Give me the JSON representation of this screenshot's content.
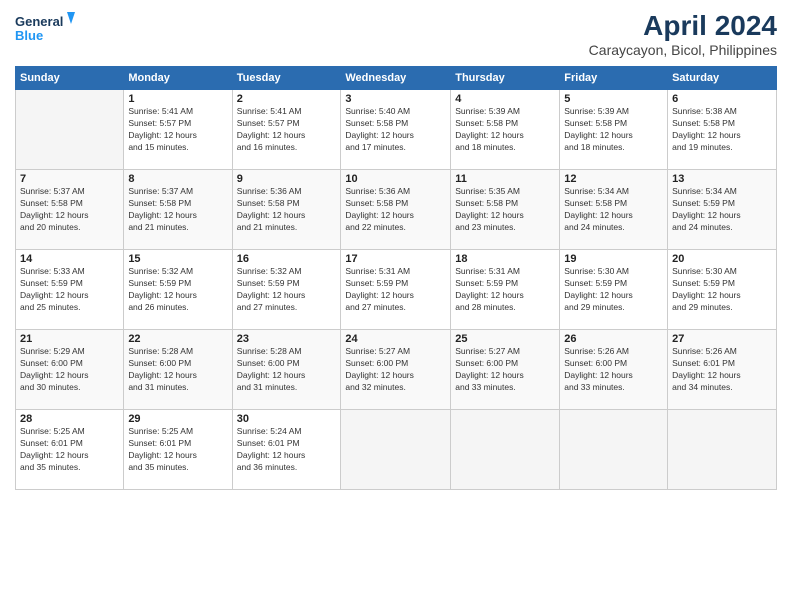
{
  "logo": {
    "line1": "General",
    "line2": "Blue"
  },
  "title": "April 2024",
  "subtitle": "Caraycayon, Bicol, Philippines",
  "days_header": [
    "Sunday",
    "Monday",
    "Tuesday",
    "Wednesday",
    "Thursday",
    "Friday",
    "Saturday"
  ],
  "weeks": [
    [
      {
        "num": "",
        "info": ""
      },
      {
        "num": "1",
        "info": "Sunrise: 5:41 AM\nSunset: 5:57 PM\nDaylight: 12 hours\nand 15 minutes."
      },
      {
        "num": "2",
        "info": "Sunrise: 5:41 AM\nSunset: 5:57 PM\nDaylight: 12 hours\nand 16 minutes."
      },
      {
        "num": "3",
        "info": "Sunrise: 5:40 AM\nSunset: 5:58 PM\nDaylight: 12 hours\nand 17 minutes."
      },
      {
        "num": "4",
        "info": "Sunrise: 5:39 AM\nSunset: 5:58 PM\nDaylight: 12 hours\nand 18 minutes."
      },
      {
        "num": "5",
        "info": "Sunrise: 5:39 AM\nSunset: 5:58 PM\nDaylight: 12 hours\nand 18 minutes."
      },
      {
        "num": "6",
        "info": "Sunrise: 5:38 AM\nSunset: 5:58 PM\nDaylight: 12 hours\nand 19 minutes."
      }
    ],
    [
      {
        "num": "7",
        "info": "Sunrise: 5:37 AM\nSunset: 5:58 PM\nDaylight: 12 hours\nand 20 minutes."
      },
      {
        "num": "8",
        "info": "Sunrise: 5:37 AM\nSunset: 5:58 PM\nDaylight: 12 hours\nand 21 minutes."
      },
      {
        "num": "9",
        "info": "Sunrise: 5:36 AM\nSunset: 5:58 PM\nDaylight: 12 hours\nand 21 minutes."
      },
      {
        "num": "10",
        "info": "Sunrise: 5:36 AM\nSunset: 5:58 PM\nDaylight: 12 hours\nand 22 minutes."
      },
      {
        "num": "11",
        "info": "Sunrise: 5:35 AM\nSunset: 5:58 PM\nDaylight: 12 hours\nand 23 minutes."
      },
      {
        "num": "12",
        "info": "Sunrise: 5:34 AM\nSunset: 5:58 PM\nDaylight: 12 hours\nand 24 minutes."
      },
      {
        "num": "13",
        "info": "Sunrise: 5:34 AM\nSunset: 5:59 PM\nDaylight: 12 hours\nand 24 minutes."
      }
    ],
    [
      {
        "num": "14",
        "info": "Sunrise: 5:33 AM\nSunset: 5:59 PM\nDaylight: 12 hours\nand 25 minutes."
      },
      {
        "num": "15",
        "info": "Sunrise: 5:32 AM\nSunset: 5:59 PM\nDaylight: 12 hours\nand 26 minutes."
      },
      {
        "num": "16",
        "info": "Sunrise: 5:32 AM\nSunset: 5:59 PM\nDaylight: 12 hours\nand 27 minutes."
      },
      {
        "num": "17",
        "info": "Sunrise: 5:31 AM\nSunset: 5:59 PM\nDaylight: 12 hours\nand 27 minutes."
      },
      {
        "num": "18",
        "info": "Sunrise: 5:31 AM\nSunset: 5:59 PM\nDaylight: 12 hours\nand 28 minutes."
      },
      {
        "num": "19",
        "info": "Sunrise: 5:30 AM\nSunset: 5:59 PM\nDaylight: 12 hours\nand 29 minutes."
      },
      {
        "num": "20",
        "info": "Sunrise: 5:30 AM\nSunset: 5:59 PM\nDaylight: 12 hours\nand 29 minutes."
      }
    ],
    [
      {
        "num": "21",
        "info": "Sunrise: 5:29 AM\nSunset: 6:00 PM\nDaylight: 12 hours\nand 30 minutes."
      },
      {
        "num": "22",
        "info": "Sunrise: 5:28 AM\nSunset: 6:00 PM\nDaylight: 12 hours\nand 31 minutes."
      },
      {
        "num": "23",
        "info": "Sunrise: 5:28 AM\nSunset: 6:00 PM\nDaylight: 12 hours\nand 31 minutes."
      },
      {
        "num": "24",
        "info": "Sunrise: 5:27 AM\nSunset: 6:00 PM\nDaylight: 12 hours\nand 32 minutes."
      },
      {
        "num": "25",
        "info": "Sunrise: 5:27 AM\nSunset: 6:00 PM\nDaylight: 12 hours\nand 33 minutes."
      },
      {
        "num": "26",
        "info": "Sunrise: 5:26 AM\nSunset: 6:00 PM\nDaylight: 12 hours\nand 33 minutes."
      },
      {
        "num": "27",
        "info": "Sunrise: 5:26 AM\nSunset: 6:01 PM\nDaylight: 12 hours\nand 34 minutes."
      }
    ],
    [
      {
        "num": "28",
        "info": "Sunrise: 5:25 AM\nSunset: 6:01 PM\nDaylight: 12 hours\nand 35 minutes."
      },
      {
        "num": "29",
        "info": "Sunrise: 5:25 AM\nSunset: 6:01 PM\nDaylight: 12 hours\nand 35 minutes."
      },
      {
        "num": "30",
        "info": "Sunrise: 5:24 AM\nSunset: 6:01 PM\nDaylight: 12 hours\nand 36 minutes."
      },
      {
        "num": "",
        "info": ""
      },
      {
        "num": "",
        "info": ""
      },
      {
        "num": "",
        "info": ""
      },
      {
        "num": "",
        "info": ""
      }
    ]
  ]
}
